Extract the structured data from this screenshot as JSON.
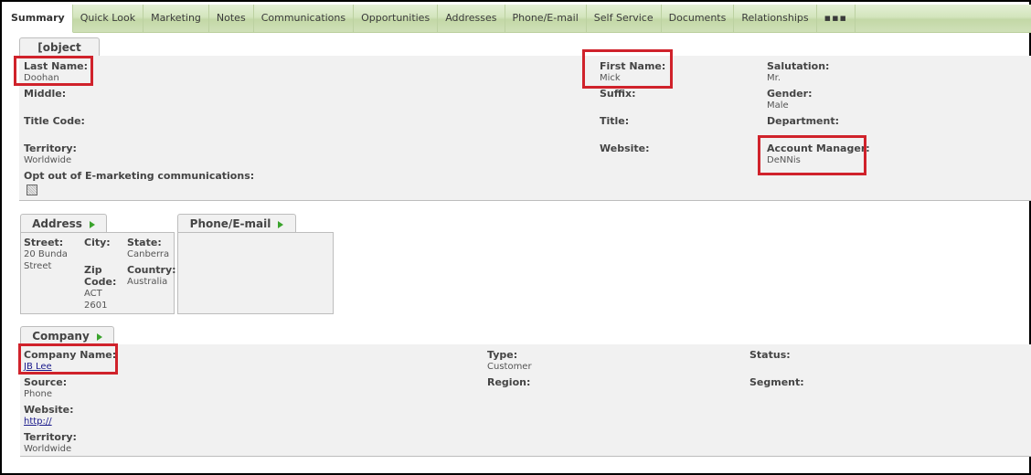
{
  "tabs": [
    {
      "label": "Summary",
      "active": true
    },
    {
      "label": "Quick Look"
    },
    {
      "label": "Marketing"
    },
    {
      "label": "Notes"
    },
    {
      "label": "Communications"
    },
    {
      "label": "Opportunities"
    },
    {
      "label": "Addresses"
    },
    {
      "label": "Phone/E-mail"
    },
    {
      "label": "Self Service"
    },
    {
      "label": "Documents"
    },
    {
      "label": "Relationships"
    },
    {
      "label": "▪▪▪",
      "icon": "more-icon"
    }
  ],
  "person": {
    "title": {
      "label": "Title:",
      "value": ""
    },
    "last_name": {
      "label": "Last Name:",
      "value": "Doohan"
    },
    "middle": {
      "label": "Middle:",
      "value": ""
    },
    "title_code": {
      "label": "Title Code:",
      "value": ""
    },
    "territory": {
      "label": "Territory:",
      "value": "Worldwide"
    },
    "opt_out": {
      "label": "Opt out of E-marketing communications:",
      "checked": false
    },
    "first_name": {
      "label": "First Name:",
      "value": "Mick"
    },
    "suffix": {
      "label": "Suffix:",
      "value": ""
    },
    "website": {
      "label": "Website:",
      "value": ""
    },
    "salutation": {
      "label": "Salutation:",
      "value": "Mr."
    },
    "gender": {
      "label": "Gender:",
      "value": "Male"
    },
    "department": {
      "label": "Department:",
      "value": ""
    },
    "account_manager": {
      "label": "Account Manager:",
      "value": "DeNNis"
    }
  },
  "address": {
    "title": "Address",
    "street": {
      "label": "Street:",
      "value_lines": [
        "20 Bunda",
        "Street"
      ]
    },
    "city": {
      "label": "City:",
      "value": ""
    },
    "state": {
      "label": "State:",
      "value": "Canberra"
    },
    "zip": {
      "label_lines": [
        "Zip",
        "Code:"
      ],
      "value_lines": [
        "ACT",
        "2601"
      ]
    },
    "country": {
      "label": "Country:",
      "value": "Australia"
    }
  },
  "phone_email": {
    "title": "Phone/E-mail"
  },
  "company": {
    "title": "Company",
    "company_name": {
      "label": "Company Name:",
      "value": "JB Lee"
    },
    "source": {
      "label": "Source:",
      "value": "Phone"
    },
    "website": {
      "label": "Website:",
      "value": "http://"
    },
    "territory": {
      "label": "Territory:",
      "value": "Worldwide"
    },
    "type": {
      "label": "Type:",
      "value": "Customer"
    },
    "region": {
      "label": "Region:",
      "value": ""
    },
    "status": {
      "label": "Status:",
      "value": ""
    },
    "segment": {
      "label": "Segment:",
      "value": ""
    }
  },
  "colors": {
    "tabbar_green": "#d3e5bd",
    "panel_bg": "#f1f1f1",
    "arrow_green": "#3aa32c",
    "highlight_red": "#d0222b",
    "link_color": "#1a1a8c"
  }
}
